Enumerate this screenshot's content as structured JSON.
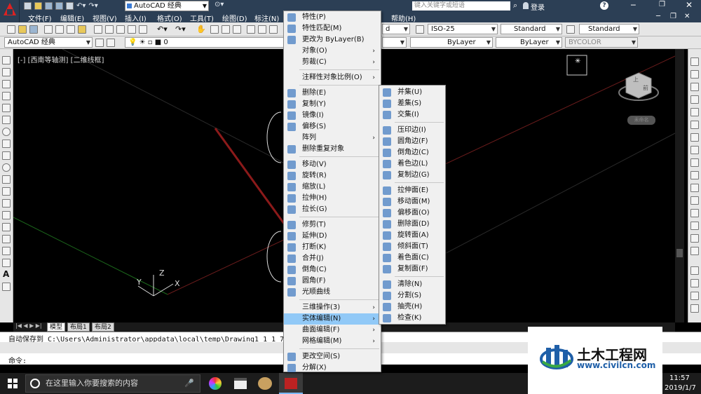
{
  "quick_access": {
    "workspace": "AutoCAD 经典",
    "search_placeholder": "键入关键字或短语",
    "login": "登录"
  },
  "menubar": [
    "文件(F)",
    "编辑(E)",
    "视图(V)",
    "插入(I)",
    "格式(O)",
    "工具(T)",
    "绘图(D)",
    "标注(N)",
    "帮助(H)"
  ],
  "toolbar1": {
    "dim_style": "ISO-25",
    "table_style": "Standard",
    "mleader_style": "Standard"
  },
  "toolbar2": {
    "workspace": "AutoCAD 经典",
    "layer": "0",
    "linetype": "ByLayer",
    "lineweight": "ByLayer",
    "plotstyle": "BYCOLOR"
  },
  "viewport": {
    "label": "[-] [西南等轴测] [二维线框]"
  },
  "ucs": {
    "x": "X",
    "y": "Y",
    "z": "Z"
  },
  "viewcube": {
    "top": "上",
    "front": "前",
    "wcs": "未命名"
  },
  "layout_tabs": [
    "模型",
    "布局1",
    "布局2"
  ],
  "command": {
    "history": "自动保存到 C:\\Users\\Administrator\\appdata\\local\\temp\\Drawing1_1_1_7711.sv$ ...",
    "prompt": "命令:"
  },
  "modify_menu": [
    {
      "label": "特性(P)",
      "icon": "properties-icon"
    },
    {
      "label": "特性匹配(M)",
      "icon": "match-prop-icon"
    },
    {
      "label": "更改为 ByLayer(B)",
      "icon": "bylayer-icon"
    },
    {
      "label": "对象(O)",
      "submenu": true
    },
    {
      "label": "剪裁(C)",
      "submenu": true
    },
    {
      "sep": true
    },
    {
      "label": "注释性对象比例(O)",
      "submenu": true
    },
    {
      "sep": true
    },
    {
      "label": "删除(E)",
      "icon": "erase-icon"
    },
    {
      "label": "复制(Y)",
      "icon": "copy-icon"
    },
    {
      "label": "镜像(I)",
      "icon": "mirror-icon"
    },
    {
      "label": "偏移(S)",
      "icon": "offset-icon"
    },
    {
      "label": "阵列",
      "submenu": true
    },
    {
      "label": "删除重复对象",
      "icon": "overkill-icon"
    },
    {
      "sep": true
    },
    {
      "label": "移动(V)",
      "icon": "move-icon"
    },
    {
      "label": "旋转(R)",
      "icon": "rotate-icon"
    },
    {
      "label": "缩放(L)",
      "icon": "scale-icon"
    },
    {
      "label": "拉伸(H)",
      "icon": "stretch-icon"
    },
    {
      "label": "拉长(G)",
      "icon": "lengthen-icon"
    },
    {
      "sep": true
    },
    {
      "label": "修剪(T)",
      "icon": "trim-icon"
    },
    {
      "label": "延伸(D)",
      "icon": "extend-icon"
    },
    {
      "label": "打断(K)",
      "icon": "break-icon"
    },
    {
      "label": "合并(J)",
      "icon": "join-icon"
    },
    {
      "label": "倒角(C)",
      "icon": "chamfer-icon"
    },
    {
      "label": "圆角(F)",
      "icon": "fillet-icon"
    },
    {
      "label": "光顺曲线",
      "icon": "blend-icon"
    },
    {
      "sep": true
    },
    {
      "label": "三维操作(3)",
      "submenu": true
    },
    {
      "label": "实体编辑(N)",
      "submenu": true,
      "highlight": true
    },
    {
      "label": "曲面编辑(F)",
      "submenu": true
    },
    {
      "label": "网格编辑(M)",
      "submenu": true
    },
    {
      "sep": true
    },
    {
      "label": "更改空间(S)",
      "icon": "chspace-icon"
    },
    {
      "label": "分解(X)",
      "icon": "explode-icon"
    }
  ],
  "solid_edit_menu": [
    {
      "label": "并集(U)",
      "icon": "union-icon"
    },
    {
      "label": "差集(S)",
      "icon": "subtract-icon"
    },
    {
      "label": "交集(I)",
      "icon": "intersect-icon"
    },
    {
      "sep": true
    },
    {
      "label": "压印边(I)",
      "icon": "imprint-icon"
    },
    {
      "label": "圆角边(F)",
      "icon": "fillet-edge-icon"
    },
    {
      "label": "倒角边(C)",
      "icon": "chamfer-edge-icon"
    },
    {
      "label": "着色边(L)",
      "icon": "color-edge-icon"
    },
    {
      "label": "复制边(G)",
      "icon": "copy-edge-icon"
    },
    {
      "sep": true
    },
    {
      "label": "拉伸面(E)",
      "icon": "extrude-face-icon"
    },
    {
      "label": "移动面(M)",
      "icon": "move-face-icon"
    },
    {
      "label": "偏移面(O)",
      "icon": "offset-face-icon"
    },
    {
      "label": "删除面(D)",
      "icon": "delete-face-icon"
    },
    {
      "label": "旋转面(A)",
      "icon": "rotate-face-icon"
    },
    {
      "label": "倾斜面(T)",
      "icon": "taper-face-icon"
    },
    {
      "label": "着色面(C)",
      "icon": "color-face-icon"
    },
    {
      "label": "复制面(F)",
      "icon": "copy-face-icon"
    },
    {
      "sep": true
    },
    {
      "label": "清除(N)",
      "icon": "clean-icon"
    },
    {
      "label": "分割(S)",
      "icon": "separate-icon"
    },
    {
      "label": "抽壳(H)",
      "icon": "shell-icon"
    },
    {
      "label": "检查(K)",
      "icon": "check-icon"
    }
  ],
  "taskbar": {
    "search": "在这里输入你要搜索的内容",
    "time": "11:57",
    "date": "2019/1/7"
  },
  "watermark": {
    "name": "土木工程网",
    "url": "www.civilcn.com"
  },
  "colors": {
    "title": "#2c3f55",
    "highlight": "#91c9f7",
    "arrow": "#8b1a1a",
    "accent": "#d22222"
  }
}
